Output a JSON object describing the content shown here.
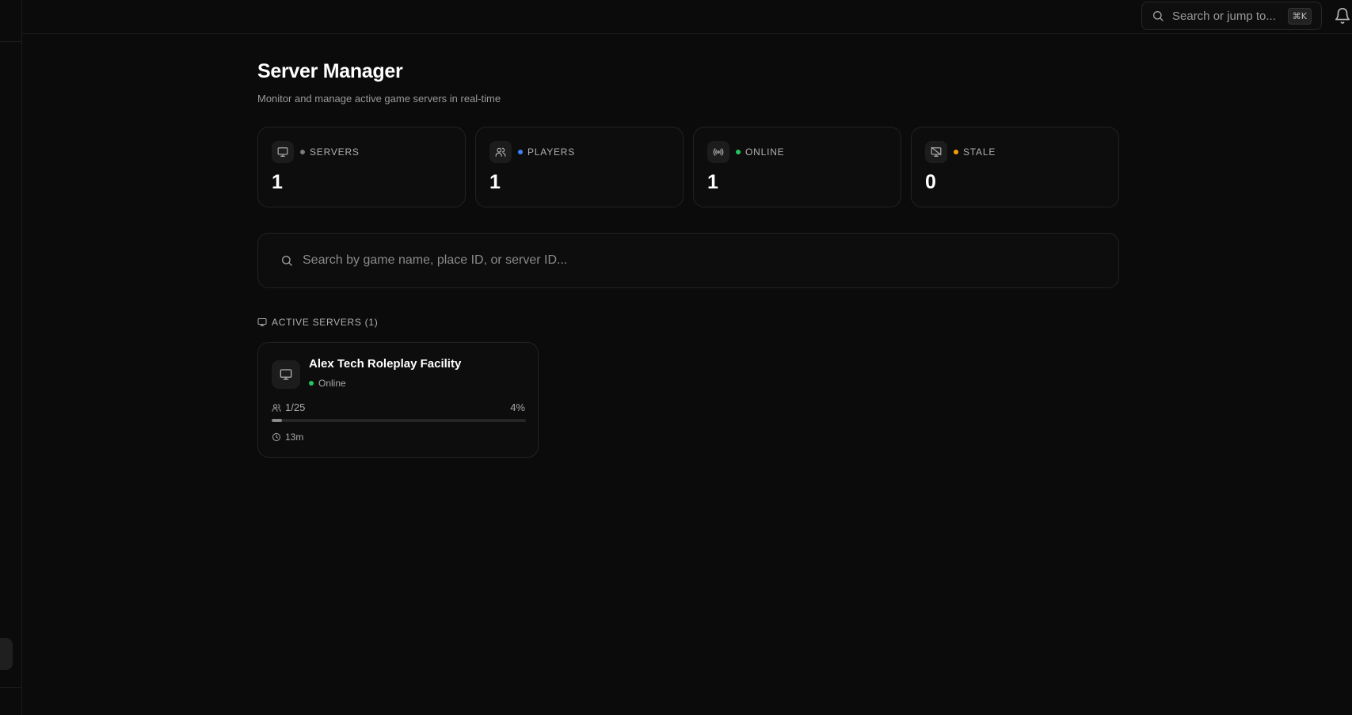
{
  "topbar": {
    "search_label": "Search or jump to...",
    "shortcut": "⌘K"
  },
  "page": {
    "title": "Server Manager",
    "subtitle": "Monitor and manage active game servers in real-time"
  },
  "stats": [
    {
      "label": "SERVERS",
      "value": "1",
      "icon": "monitor-icon",
      "dot_color": "#7a7a7a"
    },
    {
      "label": "PLAYERS",
      "value": "1",
      "icon": "users-icon",
      "dot_color": "#3b82f6"
    },
    {
      "label": "ONLINE",
      "value": "1",
      "icon": "broadcast-icon",
      "dot_color": "#22c55e"
    },
    {
      "label": "STALE",
      "value": "0",
      "icon": "monitor-off-icon",
      "dot_color": "#f59e0b"
    }
  ],
  "server_search": {
    "placeholder": "Search by game name, place ID, or server ID..."
  },
  "section": {
    "title": "ACTIVE SERVERS (1)"
  },
  "servers": [
    {
      "name": "Alex Tech Roleplay Facility",
      "status": "Online",
      "status_color": "#22c55e",
      "players": "1/25",
      "percent": "4%",
      "fill_fraction": 0.04,
      "uptime": "13m"
    }
  ]
}
